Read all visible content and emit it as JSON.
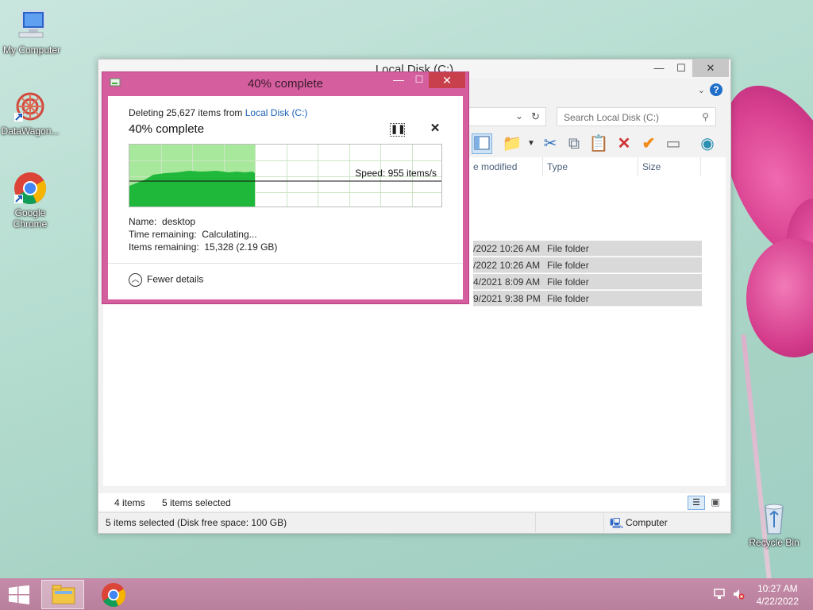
{
  "desktop": {
    "icons": [
      {
        "label": "My Computer",
        "icon": "monitor-icon"
      },
      {
        "label": "DataWagon...",
        "icon": "datawagon-icon"
      },
      {
        "label": "Google Chrome",
        "icon": "chrome-icon"
      },
      {
        "label": "Recycle Bin",
        "icon": "recycle-bin-icon"
      }
    ]
  },
  "explorer": {
    "title": "Local Disk (C:)",
    "search_placeholder": "Search Local Disk (C:)",
    "columns": {
      "date": "e modified",
      "type": "Type",
      "size": "Size"
    },
    "rows": [
      {
        "date": "/2022 10:26 AM",
        "type": "File folder"
      },
      {
        "date": "/2022 10:26 AM",
        "type": "File folder"
      },
      {
        "date": "4/2021 8:09 AM",
        "type": "File folder"
      },
      {
        "date": "9/2021 9:38 PM",
        "type": "File folder"
      }
    ],
    "item_count": "4 items",
    "selected_count": "5 items selected",
    "status_text": "5 items selected (Disk free space: 100 GB)",
    "status_location": "Computer"
  },
  "dialog": {
    "title": "40% complete",
    "deleting_prefix": "Deleting 25,627 items from ",
    "deleting_link": "Local Disk (C:)",
    "percent_label": "40% complete",
    "progress": 0.4,
    "speed": "Speed: 955 items/s",
    "name_label": "Name:",
    "name_value": "desktop",
    "time_label": "Time remaining:",
    "time_value": "Calculating...",
    "items_label": "Items remaining:",
    "items_value": "15,328 (2.19 GB)",
    "fewer_details": "Fewer details"
  },
  "taskbar": {
    "time": "10:27 AM",
    "date": "4/22/2022"
  }
}
